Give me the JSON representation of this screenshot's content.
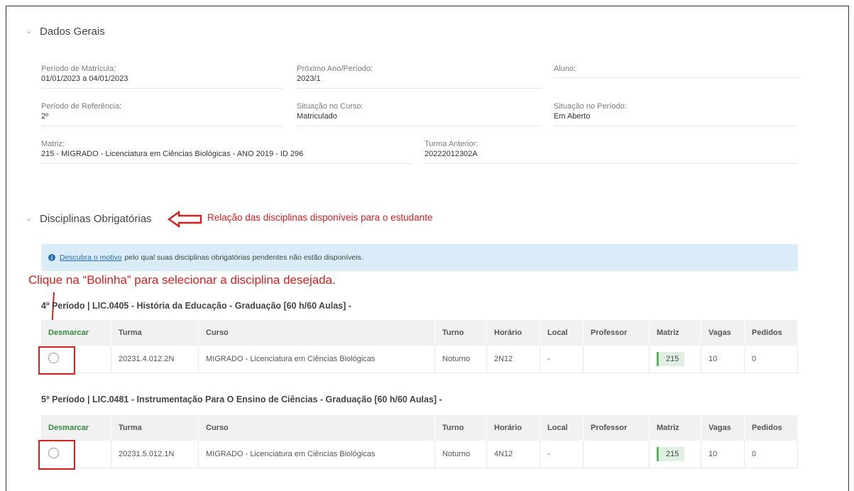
{
  "dados_gerais": {
    "title": "Dados Gerais",
    "chevron": "chevron-down-icon",
    "fields": [
      {
        "label": "Período de Matrícula:",
        "value": "01/01/2023 a 04/01/2023"
      },
      {
        "label": "Próximo Ano/Período:",
        "value": "2023/1"
      },
      {
        "label": "Aluno:",
        "value": ""
      },
      {
        "label": "Período de Referência:",
        "value": "2º"
      },
      {
        "label": "Situação no Curso:",
        "value": "Matriculado"
      },
      {
        "label": "Situação no Período:",
        "value": "Em Aberto"
      },
      {
        "label": "Matriz:",
        "value": "215 - MIGRADO - Licenciatura em Ciências Biológicas - ANO 2019 - ID 296"
      },
      {
        "label": "Turma Anterior:",
        "value": "20222012302A"
      }
    ]
  },
  "obrigatorias": {
    "title": "Disciplinas Obrigatórias",
    "annotation": "Relação das disciplinas disponíveis para o estudante"
  },
  "info": {
    "link": "Descubra o motivo",
    "text": "pelo qual suas disciplinas obrigatórias pendentes não estão disponíveis."
  },
  "instruction": "Clique na “Bolinha” para selecionar a disciplina desejada.",
  "columns": [
    "Desmarcar",
    "Turma",
    "Curso",
    "Turno",
    "Horário",
    "Local",
    "Professor",
    "Matriz",
    "Vagas",
    "Pedidos"
  ],
  "disciplinas": [
    {
      "title": "4º Período | LIC.0405 - História da Educação - Graduação [60 h/60 Aulas] -",
      "row": {
        "turma": "20231.4.012.2N",
        "curso": "MIGRADO - Licenciatura em Ciências Biológicas",
        "turno": "Noturno",
        "horario": "2N12",
        "local": "-",
        "professor": "",
        "matriz": "215",
        "vagas": "10",
        "pedidos": "0"
      }
    },
    {
      "title": "5º Período | LIC.0481 - Instrumentação Para O Ensino de Ciências - Graduação [60 h/60 Aulas] -",
      "row": {
        "turma": "20231.5.012.1N",
        "curso": "MIGRADO - Licenciatura em Ciências Biológicas",
        "turno": "Noturno",
        "horario": "4N12",
        "local": "-",
        "professor": "",
        "matriz": "215",
        "vagas": "10",
        "pedidos": "0"
      }
    }
  ],
  "colors": {
    "annotation_red": "#d62020",
    "desmarcar_green": "#2f8a3c",
    "info_bg": "#d9ecf7",
    "matriz_green": "#5cb85c"
  }
}
